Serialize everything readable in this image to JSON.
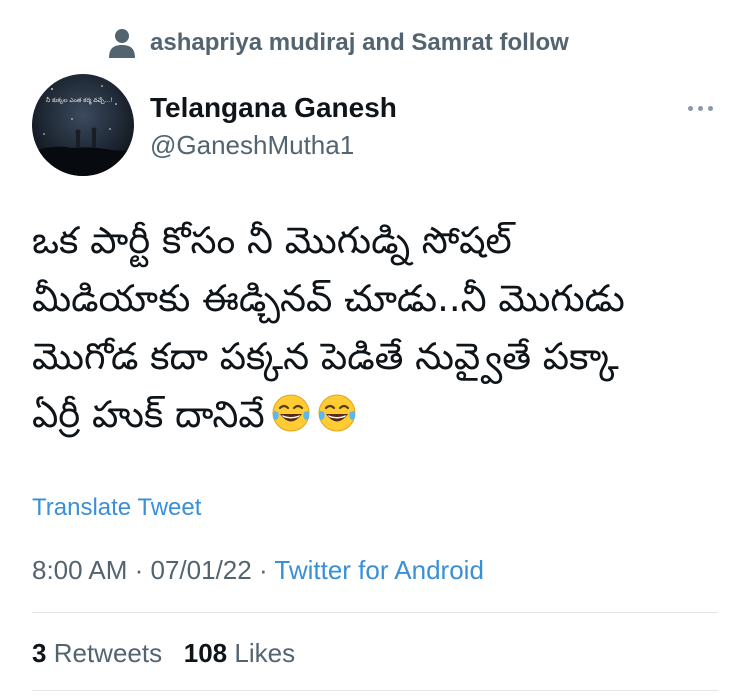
{
  "social_context": {
    "icon": "person-icon",
    "text": "ashapriya mudiraj and Samrat follow"
  },
  "author": {
    "name": "Telangana Ganesh",
    "handle": "@GaneshMutha1",
    "avatar_caption": "నీ కుక్కల ఎంత కర్మ వచ్చే...!"
  },
  "tweet": {
    "lines": [
      "ఒక పార్టీ కోసం నీ మొగుడ్ని సోషల్",
      "మీడియాకు ఈడ్చినవ్ చూడు..నీ మొగుడు",
      "మొగోడ కదా పక్కన పెడితే నువ్వైతే పక్కా",
      "ఏర్రీ హుక్ దానివే"
    ],
    "emojis": [
      "laughing-tears-emoji",
      "laughing-tears-emoji"
    ]
  },
  "translate_label": "Translate Tweet",
  "meta": {
    "time": "8:00 AM",
    "sep1": " · ",
    "date": "07/01/22",
    "sep2": " · ",
    "source": "Twitter for Android"
  },
  "stats": {
    "retweets_count": "3",
    "retweets_label": "Retweets",
    "likes_count": "108",
    "likes_label": "Likes"
  },
  "colors": {
    "link": "#3a8fd9",
    "secondary_text": "#536471",
    "primary_text": "#0f1419",
    "divider": "#e1e6ea"
  }
}
